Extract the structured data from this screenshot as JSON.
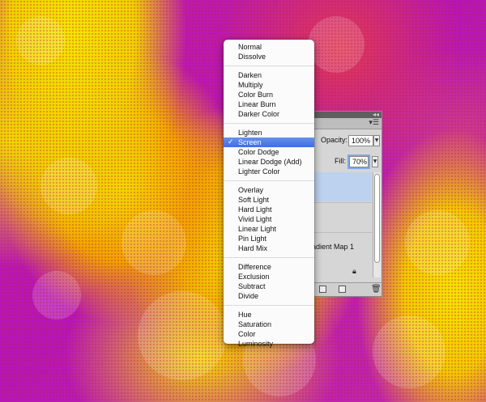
{
  "blend_menu": {
    "selected": "Screen",
    "groups": [
      [
        "Normal",
        "Dissolve"
      ],
      [
        "Darken",
        "Multiply",
        "Color Burn",
        "Linear Burn",
        "Darker Color"
      ],
      [
        "Lighten",
        "Screen",
        "Color Dodge",
        "Linear Dodge (Add)",
        "Lighter Color"
      ],
      [
        "Overlay",
        "Soft Light",
        "Hard Light",
        "Vivid Light",
        "Linear Light",
        "Pin Light",
        "Hard Mix"
      ],
      [
        "Difference",
        "Exclusion",
        "Subtract",
        "Divide"
      ],
      [
        "Hue",
        "Saturation",
        "Color",
        "Luminosity"
      ]
    ],
    "check_mark": "✓",
    "highlight_color": "#3d6fe3"
  },
  "layers_panel": {
    "opacity_label": "Opacity:",
    "opacity_value": "100%",
    "fill_label": "Fill:",
    "fill_value": "70%",
    "layer_name_partial": "adient Map 1",
    "icons": [
      "collapse-icon",
      "panel-menu-icon",
      "lock-icon",
      "new-group-icon",
      "new-layer-icon",
      "trash-icon"
    ]
  }
}
